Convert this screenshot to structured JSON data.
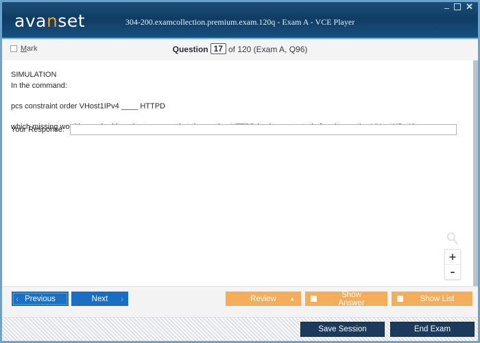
{
  "window": {
    "title": "304-200.examcollection.premium.exam.120q - Exam A - VCE Player",
    "logo_before": "ava",
    "logo_accent": "n",
    "logo_after": "set",
    "minimize_icon": "minimize-icon",
    "maximize_icon": "maximize-icon",
    "close_icon": "close-icon",
    "close_glyph": "✕",
    "minimize_glyph": "–"
  },
  "header": {
    "mark_label_initial": "M",
    "mark_label_rest": "ark",
    "question_word": "Question",
    "question_number": "17",
    "question_of": "of 120 (Exam A, Q96)"
  },
  "question": {
    "line1": "SIMULATION",
    "line2": "In the command:",
    "line3": "pcs constraint order VHost1IPv4 ____ HTTPD",
    "line4": "which missing word is required in order to ensure that the service HTTPD is always started after the service VHost1IPv4?",
    "response_label": "Your Response:",
    "response_value": "",
    "response_placeholder": ""
  },
  "zoom_widget": {
    "magnifier_icon": "magnifier-icon",
    "zoom_in": "+",
    "zoom_out": "–"
  },
  "nav": {
    "previous": "Previous",
    "previous_chevron": "‹",
    "next": "Next",
    "next_chevron": "›",
    "review": "Review",
    "review_caret": "▲",
    "show_answer": "Show Answer",
    "show_list": "Show List"
  },
  "status": {
    "save_session": "Save Session",
    "end_exam": "End Exam"
  },
  "colors": {
    "title_bar": "#0f3c63",
    "frame_border": "#6ba3cc",
    "accent_orange": "#f0a21e",
    "button_blue": "#1a6ec2",
    "button_orange": "#f4ad58",
    "button_dark": "#1c3a5c"
  }
}
